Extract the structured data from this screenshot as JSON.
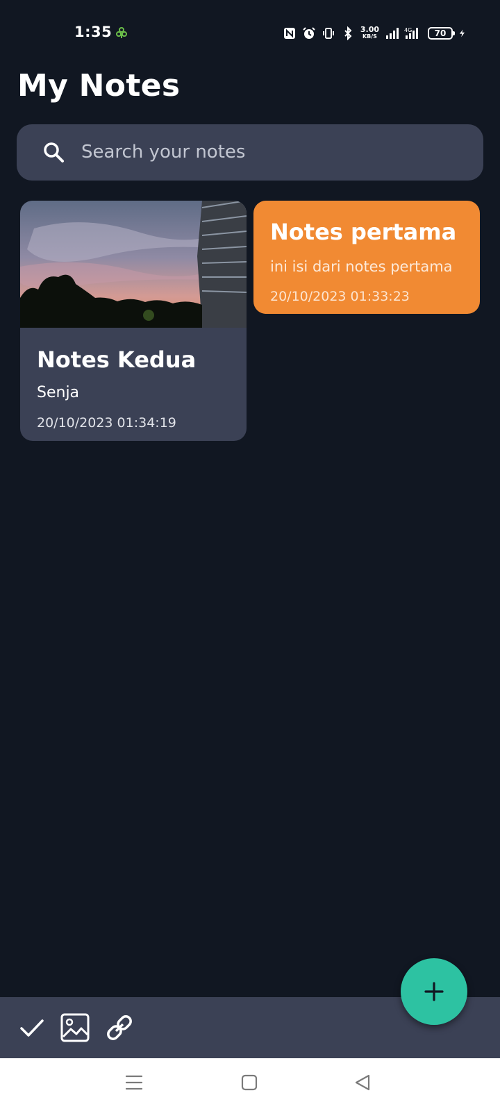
{
  "status_bar": {
    "time": "1:35",
    "speed_value": "3.00",
    "speed_unit": "KB/S",
    "network": "4G",
    "battery": "70"
  },
  "header": {
    "title": "My Notes"
  },
  "search": {
    "placeholder": "Search your notes"
  },
  "notes": [
    {
      "title": "Notes Kedua",
      "subtitle": "Senja",
      "date": "20/10/2023 01:34:19",
      "color": "#3b4155",
      "has_image": true
    },
    {
      "title": "Notes pertama",
      "subtitle": "ini isi dari notes pertama",
      "date": "20/10/2023 01:33:23",
      "color": "#f18a33",
      "has_image": false
    }
  ],
  "toolbar": {
    "icons": [
      "check-icon",
      "image-icon",
      "link-icon"
    ]
  },
  "fab": {
    "icon": "plus-icon",
    "color": "#2dc2a2"
  },
  "nav_bar": {
    "icons": [
      "menu-icon",
      "home-icon",
      "back-icon"
    ]
  },
  "colors": {
    "background": "#111722",
    "surface": "#3b4155",
    "accent_orange": "#f18a33",
    "accent_teal": "#2dc2a2"
  }
}
